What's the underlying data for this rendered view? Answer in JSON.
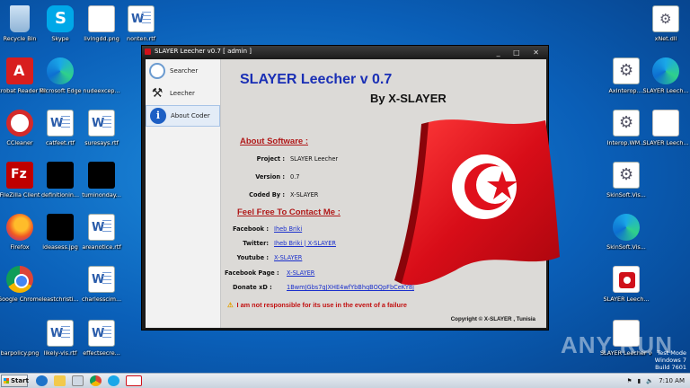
{
  "desktop": {
    "left_icons": [
      {
        "name": "Recycle Bin",
        "kind": "bin"
      },
      {
        "name": "Skype",
        "kind": "skype"
      },
      {
        "name": "livingdd.png",
        "kind": "png"
      },
      {
        "name": "nonten.rtf",
        "kind": "doc"
      },
      {
        "name": "Acrobat Reader DC",
        "kind": "acro"
      },
      {
        "name": "Microsoft Edge",
        "kind": "edge"
      },
      {
        "name": "nudeexcep...",
        "kind": "blank"
      },
      {
        "name": "CCleaner",
        "kind": "ccl"
      },
      {
        "name": "catfeet.rtf",
        "kind": "doc"
      },
      {
        "name": "suresays.rtf",
        "kind": "doc"
      },
      {
        "name": "FileZilla Client",
        "kind": "fz"
      },
      {
        "name": "definitionin...",
        "kind": "blk"
      },
      {
        "name": "tuminonday...",
        "kind": "blk"
      },
      {
        "name": "Firefox",
        "kind": "ff"
      },
      {
        "name": "ideasess.jpg",
        "kind": "blk"
      },
      {
        "name": "areanotice.rtf",
        "kind": "doc"
      },
      {
        "name": "Google Chrome",
        "kind": "chrome"
      },
      {
        "name": "leastchristi...",
        "kind": "blank"
      },
      {
        "name": "charlesscim...",
        "kind": "doc"
      },
      {
        "name": "barpolicy.png",
        "kind": "blank"
      },
      {
        "name": "likely-vis.rtf",
        "kind": "doc"
      },
      {
        "name": "effectsecre...",
        "kind": "doc"
      }
    ],
    "right_icons": [
      {
        "name": "xNet.dll",
        "kind": "dll"
      },
      {
        "name": "AxInterop....",
        "kind": "gear"
      },
      {
        "name": "SLAYER Leech...",
        "kind": "edge"
      },
      {
        "name": "Interop.WM...",
        "kind": "gear"
      },
      {
        "name": "SLAYER Leech...",
        "kind": "png"
      },
      {
        "name": "SkinSoft.Vis...",
        "kind": "gear"
      },
      {
        "name": "SkinSoft.Vis...",
        "kind": "edge"
      },
      {
        "name": "SLAYER Leech...",
        "kind": "slayer"
      },
      {
        "name": "SLAYER Leecher v0...",
        "kind": "png"
      }
    ]
  },
  "window": {
    "title": "SLAYER Leecher v0.7 [ admin ]",
    "controls": "_ □ ✕",
    "nav": [
      {
        "label": "Searcher",
        "icon": "search-icon"
      },
      {
        "label": "Leecher",
        "icon": "tools-icon"
      },
      {
        "label": "About Coder",
        "icon": "info-icon"
      }
    ],
    "app_title": "SLAYER Leecher v 0.7",
    "byline": "By X-SLAYER",
    "about_heading": "About Software :",
    "about": [
      {
        "key": "Project :",
        "value": "SLAYER Leecher"
      },
      {
        "key": "Version :",
        "value": "0.7"
      },
      {
        "key": "Coded By :",
        "value": "X-SLAYER"
      }
    ],
    "contact_heading": "Feel Free To Contact Me :",
    "contact": [
      {
        "key": "Facebook :",
        "value": "Iheb Briki"
      },
      {
        "key": "Twitter:",
        "value": "Iheb Briki | X-SLAYER"
      },
      {
        "key": "Youtube :",
        "value": "X-SLAYER"
      },
      {
        "key": "Facebook Page :",
        "value": "X-SLAYER"
      },
      {
        "key": "Donate xD :",
        "value": "1BwmJGbs7gJXHE4wfYbBhqBOQpFbCeKY8j"
      }
    ],
    "warning": "I am not responsible for its use in the event of a failure",
    "copyright": "Copyright © X-SLAYER , Tunisia",
    "flag_colors": {
      "red": "#e0101c",
      "white": "#ffffff"
    }
  },
  "watermark": "ANY RUN",
  "test_mode": [
    "Test Mode",
    "Windows 7",
    "Build 7601"
  ],
  "taskbar": {
    "start_label": "Start",
    "clock": "7:10 AM"
  }
}
